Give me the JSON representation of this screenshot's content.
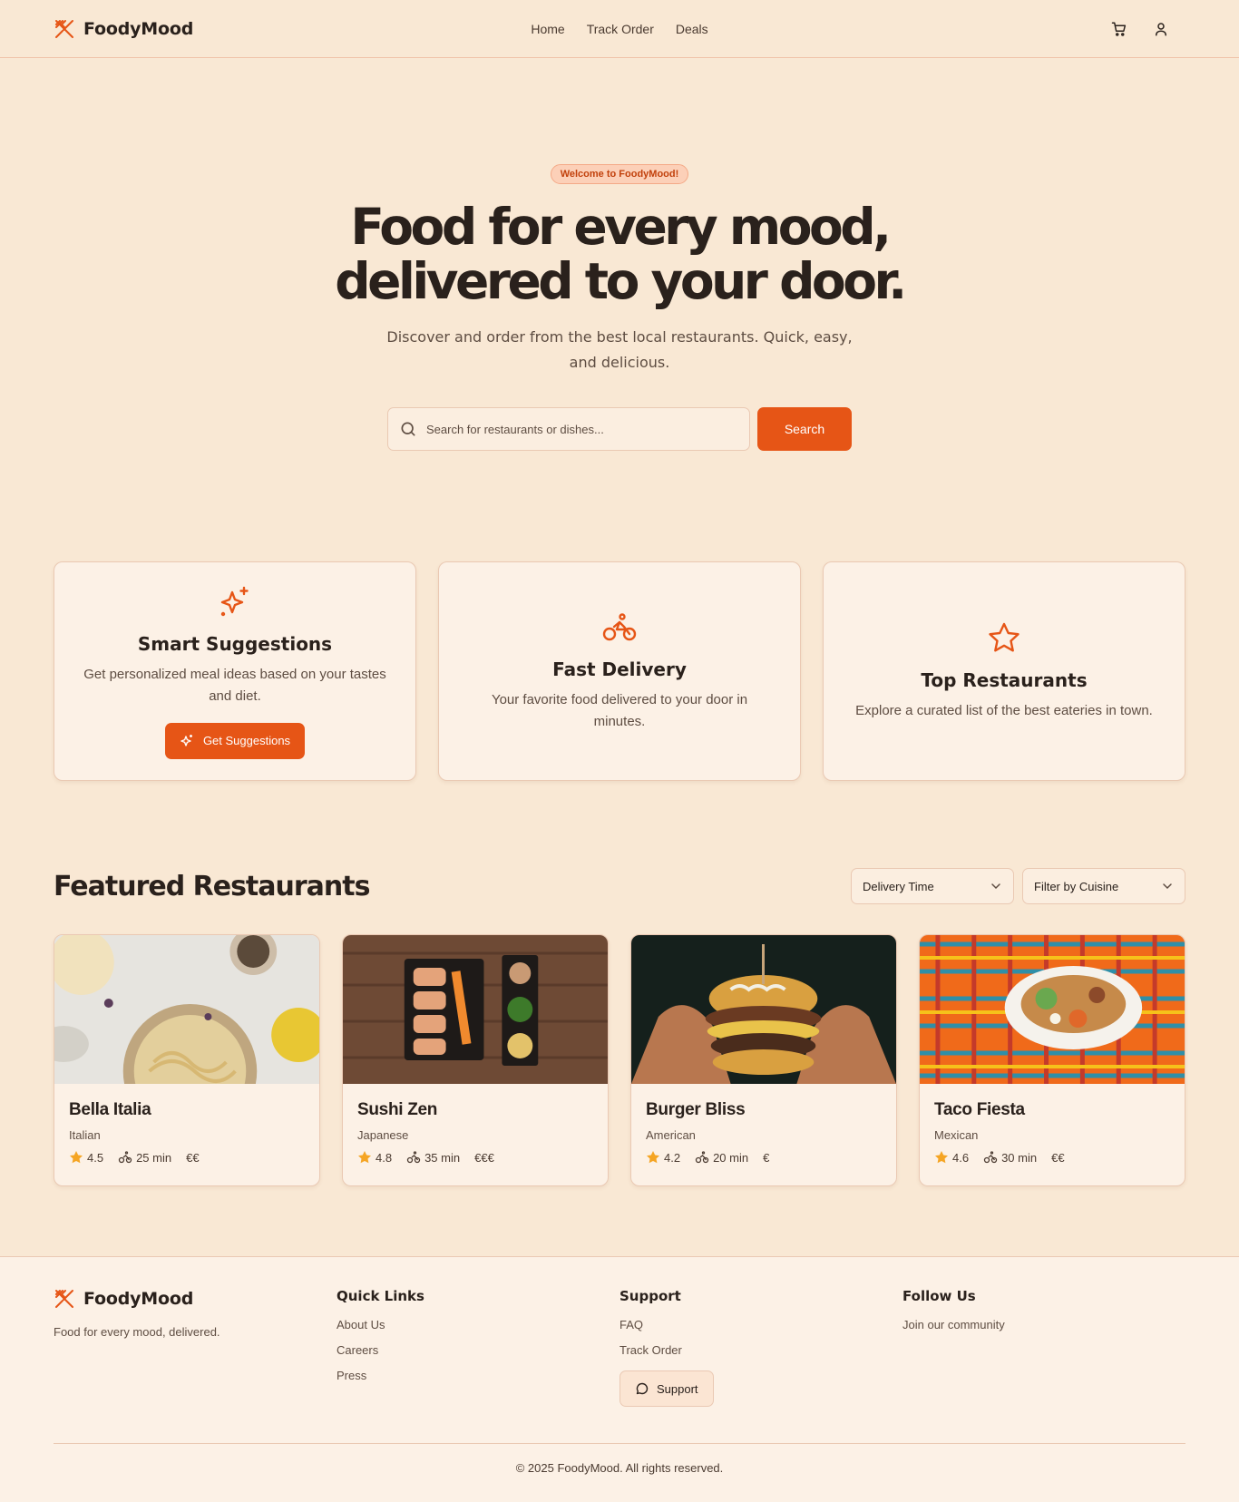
{
  "brand": {
    "name": "FoodyMood",
    "accent": "#e65516",
    "background": "#f9e8d4"
  },
  "nav": {
    "items": [
      "Home",
      "Track Order",
      "Deals"
    ]
  },
  "header_icons": [
    "cart-icon",
    "user-icon"
  ],
  "hero": {
    "badge": "Welcome to FoodyMood!",
    "title_line1": "Food for every mood,",
    "title_line2": "delivered to your door.",
    "subtitle": "Discover and order from the best local restaurants. Quick, easy, and delicious.",
    "search_placeholder": "Search for restaurants or dishes...",
    "search_button": "Search"
  },
  "features": [
    {
      "icon": "sparkles-icon",
      "title": "Smart Suggestions",
      "text": "Get personalized meal ideas based on your tastes and diet.",
      "button": "Get Suggestions"
    },
    {
      "icon": "bike-icon",
      "title": "Fast Delivery",
      "text": "Your favorite food delivered to your door in minutes."
    },
    {
      "icon": "star-icon",
      "title": "Top Restaurants",
      "text": "Explore a curated list of the best eateries in town."
    }
  ],
  "featured": {
    "title": "Featured Restaurants",
    "filter_delivery": "Delivery Time",
    "filter_cuisine": "Filter by Cuisine",
    "restaurants": [
      {
        "name": "Bella Italia",
        "cuisine": "Italian",
        "rating": "4.5",
        "time": "25 min",
        "price": "€€"
      },
      {
        "name": "Sushi Zen",
        "cuisine": "Japanese",
        "rating": "4.8",
        "time": "35 min",
        "price": "€€€"
      },
      {
        "name": "Burger Bliss",
        "cuisine": "American",
        "rating": "4.2",
        "time": "20 min",
        "price": "€"
      },
      {
        "name": "Taco Fiesta",
        "cuisine": "Mexican",
        "rating": "4.6",
        "time": "30 min",
        "price": "€€"
      }
    ]
  },
  "footer": {
    "tagline": "Food for every mood, delivered.",
    "quick_links": {
      "title": "Quick Links",
      "items": [
        "About Us",
        "Careers",
        "Press"
      ]
    },
    "support": {
      "title": "Support",
      "items": [
        "FAQ",
        "Track Order"
      ],
      "button": "Support"
    },
    "follow": {
      "title": "Follow Us",
      "text": "Join our community"
    },
    "copyright": "© 2025 FoodyMood. All rights reserved."
  }
}
